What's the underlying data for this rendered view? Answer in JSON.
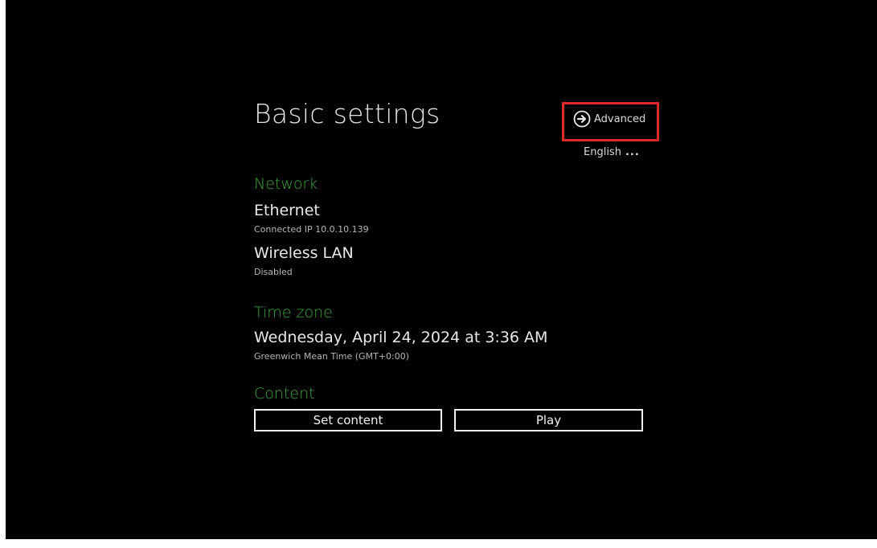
{
  "header": {
    "title": "Basic settings",
    "advanced_label": "Advanced",
    "advanced_icon": "arrow-right-circle-icon",
    "language_label": "English",
    "language_more": "..."
  },
  "network": {
    "section_label": "Network",
    "ethernet": {
      "label": "Ethernet",
      "status": "Connected IP 10.0.10.139"
    },
    "wireless": {
      "label": "Wireless LAN",
      "status": "Disabled"
    }
  },
  "time_zone": {
    "section_label": "Time zone",
    "datetime": "Wednesday, April 24, 2024 at 3:36 AM",
    "zone": "Greenwich Mean Time (GMT+0:00)"
  },
  "content": {
    "section_label": "Content",
    "set_content_label": "Set content",
    "play_label": "Play"
  },
  "colors": {
    "background": "#000000",
    "section_accent": "#3aa43a",
    "highlight": "#e02a2a",
    "text": "#e8e8e8"
  }
}
